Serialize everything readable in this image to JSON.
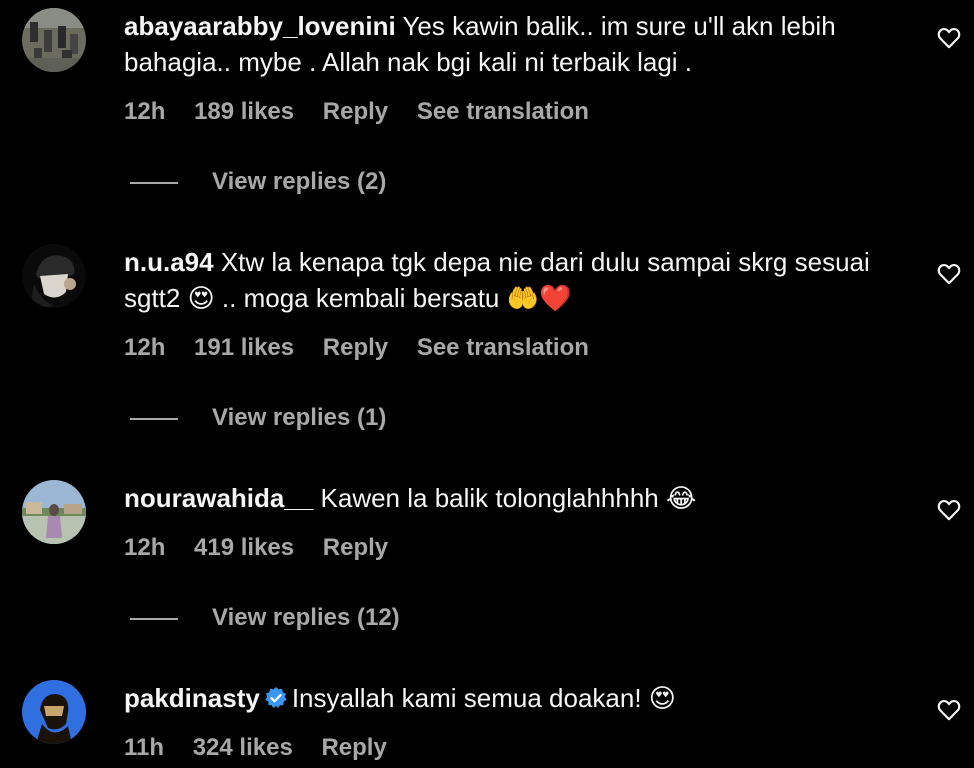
{
  "comments": [
    {
      "username": "abayaarabby_lovenini",
      "text": "Yes kawin balik.. im sure u'll akn lebih bahagia.. mybe . Allah nak bgi kali ni terbaik lagi .",
      "time": "12h",
      "likes": "189 likes",
      "reply": "Reply",
      "translation": "See translation",
      "view_replies": "View replies (2)",
      "avatar_color": "#6b6b5e",
      "verified": false
    },
    {
      "username": "n.u.a94",
      "text": "Xtw la kenapa tgk depa nie dari dulu sampai skrg sesuai sgtt2 😍 .. moga kembali bersatu 🤲❤️",
      "time": "12h",
      "likes": "191 likes",
      "reply": "Reply",
      "translation": "See translation",
      "view_replies": "View replies (1)",
      "avatar_color": "#111111",
      "verified": false
    },
    {
      "username": "nourawahida__",
      "text": "Kawen la balik tolonglahhhhh 😂",
      "time": "12h",
      "likes": "419 likes",
      "reply": "Reply",
      "view_replies": "View replies (12)",
      "avatar_color": "#9bb7d4",
      "verified": false
    },
    {
      "username": "pakdinasty",
      "text": "Insyallah kami semua doakan! 😍",
      "time": "11h",
      "likes": "324 likes",
      "reply": "Reply",
      "avatar_color": "#2f6fe0",
      "verified": true
    }
  ],
  "colors": {
    "background": "#000000",
    "text": "#f5f5f5",
    "muted": "#a8a8a8",
    "verified": "#3897f0"
  }
}
